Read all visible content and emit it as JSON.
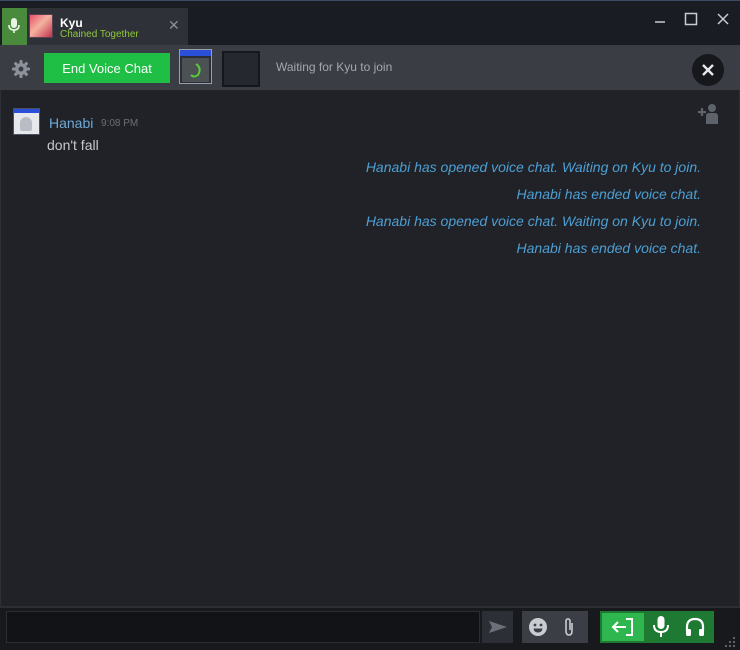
{
  "tab": {
    "name": "Kyu",
    "status": "Chained Together",
    "close_glyph": "✕"
  },
  "voice": {
    "end_label": "End Voice Chat",
    "waiting_text": "Waiting for Kyu to join"
  },
  "messages": {
    "author": "Hanabi",
    "time": "9:08 PM",
    "text": "don't fall",
    "system": [
      "Hanabi has opened voice chat. Waiting on Kyu to join.",
      "Hanabi has ended voice chat.",
      "Hanabi has opened voice chat. Waiting on Kyu to join.",
      "Hanabi has ended voice chat."
    ]
  },
  "input": {
    "value": "",
    "placeholder": ""
  },
  "colors": {
    "end_voice_button": "#1fbf45",
    "author_name": "#6fa8d6",
    "system_message": "#4d9fd4",
    "tab_status": "#8fc93a",
    "voice_active": "#2fb64e"
  },
  "icons": [
    "microphone-icon",
    "close-icon",
    "minimize-icon",
    "maximize-icon",
    "gear-icon",
    "add-friend-icon",
    "send-icon",
    "emoji-icon",
    "paperclip-icon",
    "leave-voice-icon",
    "headset-icon",
    "resize-grip-icon"
  ]
}
